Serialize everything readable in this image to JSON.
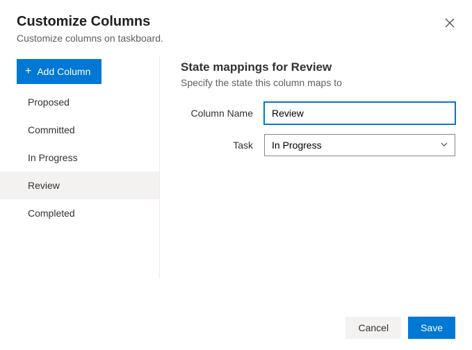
{
  "header": {
    "title": "Customize Columns",
    "subtitle": "Customize columns on taskboard."
  },
  "sidebar": {
    "add_button_label": "Add Column",
    "items": [
      {
        "label": "Proposed",
        "selected": false
      },
      {
        "label": "Committed",
        "selected": false
      },
      {
        "label": "In Progress",
        "selected": false
      },
      {
        "label": "Review",
        "selected": true
      },
      {
        "label": "Completed",
        "selected": false
      }
    ]
  },
  "main": {
    "section_title": "State mappings for Review",
    "section_subtitle": "Specify the state this column maps to",
    "column_name_label": "Column Name",
    "column_name_value": "Review",
    "task_label": "Task",
    "task_value": "In Progress"
  },
  "footer": {
    "cancel_label": "Cancel",
    "save_label": "Save"
  }
}
